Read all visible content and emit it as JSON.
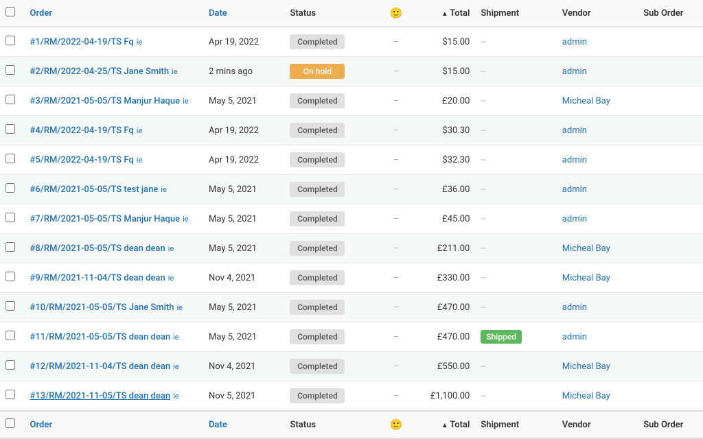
{
  "table": {
    "columns": [
      {
        "id": "checkbox",
        "label": ""
      },
      {
        "id": "order",
        "label": "Order",
        "sortable": true,
        "color": true
      },
      {
        "id": "date",
        "label": "Date",
        "sortable": false,
        "color": true
      },
      {
        "id": "status",
        "label": "Status",
        "sortable": false,
        "color": false
      },
      {
        "id": "icon",
        "label": "🙂",
        "sortable": false,
        "color": false
      },
      {
        "id": "total",
        "label": "Total",
        "sortable": true,
        "sorted": "asc",
        "color": false
      },
      {
        "id": "shipment",
        "label": "Shipment",
        "sortable": false,
        "color": false
      },
      {
        "id": "vendor",
        "label": "Vendor",
        "sortable": false,
        "color": false
      },
      {
        "id": "suborder",
        "label": "Sub Order",
        "sortable": false,
        "color": false
      }
    ],
    "rows": [
      {
        "id": 1,
        "order": "#1/RM/2022-04-19/TS Fq",
        "order_underline": false,
        "date": "Apr 19, 2022",
        "status": "Completed",
        "status_type": "completed",
        "total": "$15.00",
        "shipment": "--",
        "shipment_type": "text",
        "vendor": "admin",
        "suborder": ""
      },
      {
        "id": 2,
        "order": "#2/RM/2022-04-25/TS Jane Smith",
        "order_underline": false,
        "date": "2 mins ago",
        "status": "On hold",
        "status_type": "onhold",
        "total": "$15.00",
        "shipment": "--",
        "shipment_type": "text",
        "vendor": "admin",
        "suborder": ""
      },
      {
        "id": 3,
        "order": "#3/RM/2021-05-05/TS Manjur Haque",
        "order_underline": false,
        "date": "May 5, 2021",
        "status": "Completed",
        "status_type": "completed",
        "total": "£20.00",
        "shipment": "--",
        "shipment_type": "text",
        "vendor": "Micheal Bay",
        "suborder": ""
      },
      {
        "id": 4,
        "order": "#4/RM/2022-04-19/TS Fq",
        "order_underline": false,
        "date": "Apr 19, 2022",
        "status": "Completed",
        "status_type": "completed",
        "total": "$30.30",
        "shipment": "--",
        "shipment_type": "text",
        "vendor": "admin",
        "suborder": ""
      },
      {
        "id": 5,
        "order": "#5/RM/2022-04-19/TS Fq",
        "order_underline": false,
        "date": "Apr 19, 2022",
        "status": "Completed",
        "status_type": "completed",
        "total": "$32.30",
        "shipment": "--",
        "shipment_type": "text",
        "vendor": "admin",
        "suborder": ""
      },
      {
        "id": 6,
        "order": "#6/RM/2021-05-05/TS test jane",
        "order_underline": false,
        "date": "May 5, 2021",
        "status": "Completed",
        "status_type": "completed",
        "total": "£36.00",
        "shipment": "--",
        "shipment_type": "text",
        "vendor": "admin",
        "suborder": ""
      },
      {
        "id": 7,
        "order": "#7/RM/2021-05-05/TS Manjur Haque",
        "order_underline": false,
        "date": "May 5, 2021",
        "status": "Completed",
        "status_type": "completed",
        "total": "£45.00",
        "shipment": "--",
        "shipment_type": "text",
        "vendor": "admin",
        "suborder": ""
      },
      {
        "id": 8,
        "order": "#8/RM/2021-05-05/TS dean dean",
        "order_underline": false,
        "date": "May 5, 2021",
        "status": "Completed",
        "status_type": "completed",
        "total": "£211.00",
        "shipment": "--",
        "shipment_type": "text",
        "vendor": "Micheal Bay",
        "suborder": ""
      },
      {
        "id": 9,
        "order": "#9/RM/2021-11-04/TS dean dean",
        "order_underline": false,
        "date": "Nov 4, 2021",
        "status": "Completed",
        "status_type": "completed",
        "total": "£330.00",
        "shipment": "--",
        "shipment_type": "text",
        "vendor": "Micheal Bay",
        "suborder": ""
      },
      {
        "id": 10,
        "order": "#10/RM/2021-05-05/TS Jane Smith",
        "order_underline": false,
        "date": "May 5, 2021",
        "status": "Completed",
        "status_type": "completed",
        "total": "£470.00",
        "shipment": "--",
        "shipment_type": "text",
        "vendor": "admin",
        "suborder": ""
      },
      {
        "id": 11,
        "order": "#11/RM/2021-05-05/TS dean dean",
        "order_underline": false,
        "date": "May 5, 2021",
        "status": "Completed",
        "status_type": "completed",
        "total": "£470.00",
        "shipment": "Shipped",
        "shipment_type": "badge",
        "vendor": "admin",
        "suborder": ""
      },
      {
        "id": 12,
        "order": "#12/RM/2021-11-04/TS dean dean",
        "order_underline": false,
        "date": "Nov 4, 2021",
        "status": "Completed",
        "status_type": "completed",
        "total": "£550.00",
        "shipment": "--",
        "shipment_type": "text",
        "vendor": "Micheal Bay",
        "suborder": ""
      },
      {
        "id": 13,
        "order": "#13/RM/2021-11-05/TS dean dean",
        "order_underline": true,
        "date": "Nov 5, 2021",
        "status": "Completed",
        "status_type": "completed",
        "total": "£1,100.00",
        "shipment": "--",
        "shipment_type": "text",
        "vendor": "Micheal Bay",
        "suborder": ""
      }
    ],
    "footer_columns": [
      {
        "label": "Order",
        "color": true
      },
      {
        "label": "Date",
        "color": true
      },
      {
        "label": "Status",
        "color": false
      },
      {
        "label": "🙂",
        "color": false
      },
      {
        "label": "Total",
        "sorted": "asc",
        "color": false
      },
      {
        "label": "Shipment",
        "color": false
      },
      {
        "label": "Vendor",
        "color": false
      },
      {
        "label": "Sub Order",
        "color": false
      }
    ]
  }
}
